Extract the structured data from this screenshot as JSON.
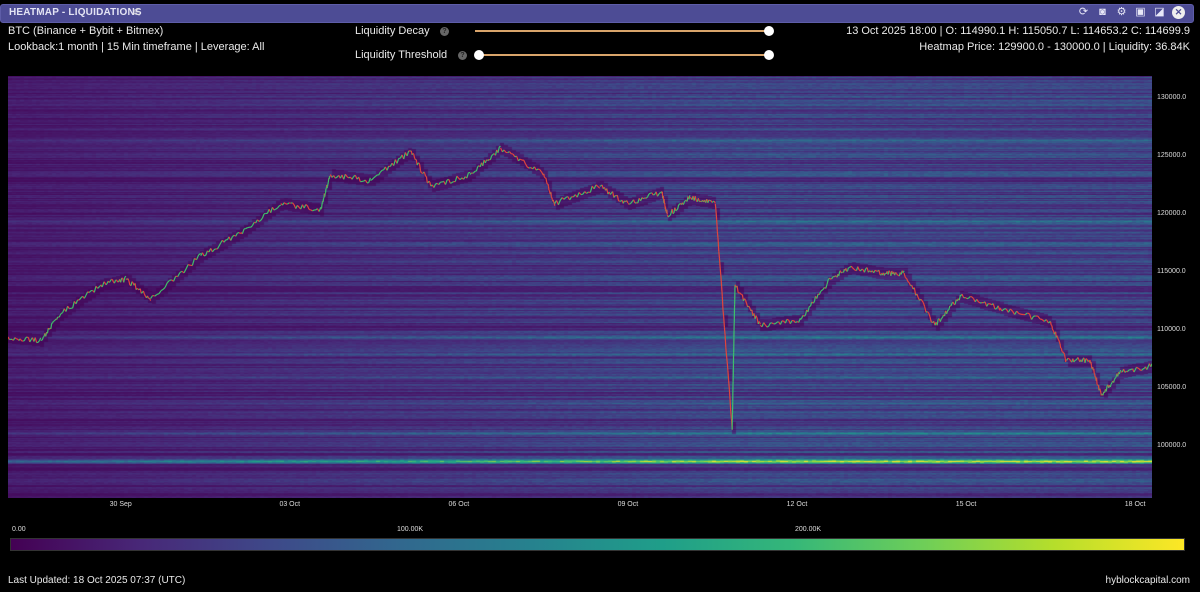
{
  "window": {
    "title": "HEATMAP - LIQUIDATIONS",
    "icons": [
      "filter-icon",
      "refresh-icon",
      "camera-icon",
      "gear-icon",
      "save-icon",
      "expand-icon",
      "close-icon"
    ]
  },
  "header": {
    "symbol": "BTC (Binance + Bybit + Bitmex)",
    "settings": "Lookback:1 month | 15 Min timeframe | Leverage: All",
    "ohlc": "13 Oct 2025 18:00 | O: 114990.1 H: 115050.7 L: 114653.2 C: 114699.9",
    "hover": "Heatmap Price: 129900.0 - 130000.0 | Liquidity: 36.84K"
  },
  "controls": {
    "decay_label": "Liquidity Decay",
    "decay_value": 1.0,
    "threshold_label": "Liquidity Threshold",
    "threshold_range": [
      0.0,
      1.0
    ],
    "help": "?"
  },
  "footer": {
    "updated": "Last Updated: 18 Oct 2025 07:37 (UTC)",
    "brand": "hyblockcapital.com"
  },
  "colors": {
    "title_bar": "#4d4c95",
    "price_up": "#3fbf6a",
    "price_down": "#e0453c",
    "slider": "#d9a46a"
  },
  "chart_data": {
    "type": "heatmap",
    "title": "Liquidation Heatmap",
    "y_ticks": [
      "130000.0",
      "125000.0",
      "120000.0",
      "115000.0",
      "110000.0",
      "105000.0",
      "100000.0"
    ],
    "y_tick_values": [
      130000,
      125000,
      120000,
      115000,
      110000,
      105000,
      100000
    ],
    "ylim": [
      95600,
      132000
    ],
    "x_ticks": [
      "30 Sep",
      "03 Oct",
      "06 Oct",
      "09 Oct",
      "12 Oct",
      "15 Oct",
      "18 Oct"
    ],
    "x_tick_days": [
      0,
      3,
      6,
      9,
      12,
      15,
      18
    ],
    "xlim_days": [
      -2.0,
      18.3
    ],
    "x_unit": "days since 30 Sep 2025",
    "colorbar": {
      "ticks": [
        "0.00",
        "100.00K",
        "200.00K"
      ],
      "tick_values": [
        0,
        100000,
        200000
      ],
      "range": [
        0,
        300000
      ],
      "colormap": "viridis"
    },
    "price_series": {
      "name": "BTC price",
      "x": [
        -2.0,
        -1.42,
        -1.06,
        -0.35,
        0.09,
        0.53,
        1.42,
        2.13,
        2.84,
        3.55,
        3.72,
        4.43,
        5.14,
        5.5,
        6.2,
        6.74,
        7.5,
        7.7,
        8.5,
        9.0,
        9.6,
        9.7,
        10.1,
        10.55,
        10.85,
        10.9,
        11.35,
        12.06,
        12.6,
        12.94,
        13.5,
        13.9,
        14.45,
        14.9,
        15.6,
        16.5,
        16.77,
        17.2,
        17.4,
        17.75,
        18.3
      ],
      "y": [
        109500,
        109200,
        111500,
        114000,
        114500,
        112800,
        116500,
        118500,
        121000,
        120500,
        123500,
        123000,
        125500,
        122500,
        123500,
        125800,
        123500,
        121000,
        122500,
        121000,
        122000,
        120000,
        121500,
        121000,
        101500,
        114000,
        110500,
        111000,
        114500,
        115500,
        115000,
        115000,
        110500,
        113000,
        112000,
        110800,
        107500,
        107500,
        104500,
        106500,
        107000
      ]
    },
    "liquidity_levels": [
      {
        "price": 131000,
        "value": 60000
      },
      {
        "price": 126500,
        "value": 110000
      },
      {
        "price": 125300,
        "value": 90000
      },
      {
        "price": 122500,
        "value": 80000
      },
      {
        "price": 119500,
        "value": 120000
      },
      {
        "price": 117500,
        "value": 95000
      },
      {
        "price": 116000,
        "value": 85000
      },
      {
        "price": 111500,
        "value": 90000
      },
      {
        "price": 109500,
        "value": 130000
      },
      {
        "price": 108000,
        "value": 120000
      },
      {
        "price": 106000,
        "value": 110000
      },
      {
        "price": 103800,
        "value": 100000
      },
      {
        "price": 101200,
        "value": 140000
      },
      {
        "price": 98800,
        "value": 280000
      },
      {
        "price": 97500,
        "value": 70000
      }
    ]
  }
}
